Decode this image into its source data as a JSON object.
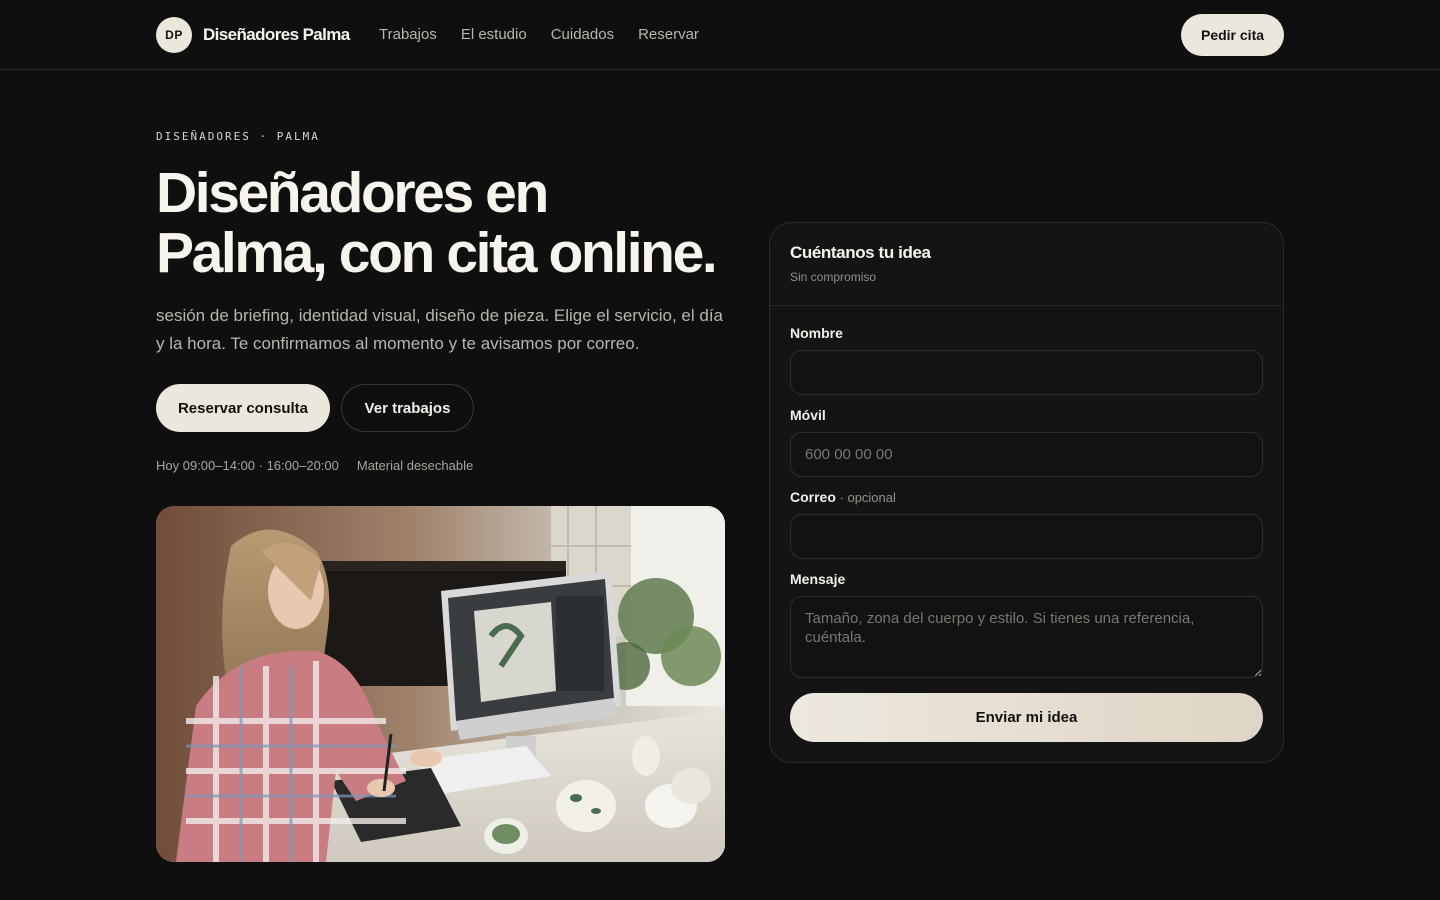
{
  "header": {
    "logo_initials": "DP",
    "brand": "Diseñadores Palma",
    "nav": [
      "Trabajos",
      "El estudio",
      "Cuidados",
      "Reservar"
    ],
    "cta": "Pedir cita"
  },
  "hero": {
    "eyebrow": "DISEÑADORES · PALMA",
    "title_line1": "Diseñadores en",
    "title_line2": "Palma, con cita online.",
    "subtitle": "sesión de briefing, identidad visual, diseño de pieza. Elige el servicio, el día y la hora. Te confirmamos al momento y te avisamos por correo.",
    "primary_button": "Reservar consulta",
    "secondary_button": "Ver trabajos",
    "hours": "Hoy 09:00–14:00 · 16:00–20:00",
    "note": "Material desechable"
  },
  "form": {
    "title": "Cuéntanos tu idea",
    "subtitle": "Sin compromiso",
    "name_label": "Nombre",
    "name_value": "",
    "mobile_label": "Móvil",
    "mobile_placeholder": "600 00 00 00",
    "email_label": "Correo",
    "email_optional": " · opcional",
    "email_value": "",
    "message_label": "Mensaje",
    "message_placeholder": "Tamaño, zona del cuerpo y estilo. Si tienes una referencia, cuéntala.",
    "submit": "Enviar mi idea"
  },
  "colors": {
    "background": "#0f0f0f",
    "accent": "#ece7dc",
    "card": "#141414",
    "muted_text": "#b9b5ad"
  }
}
